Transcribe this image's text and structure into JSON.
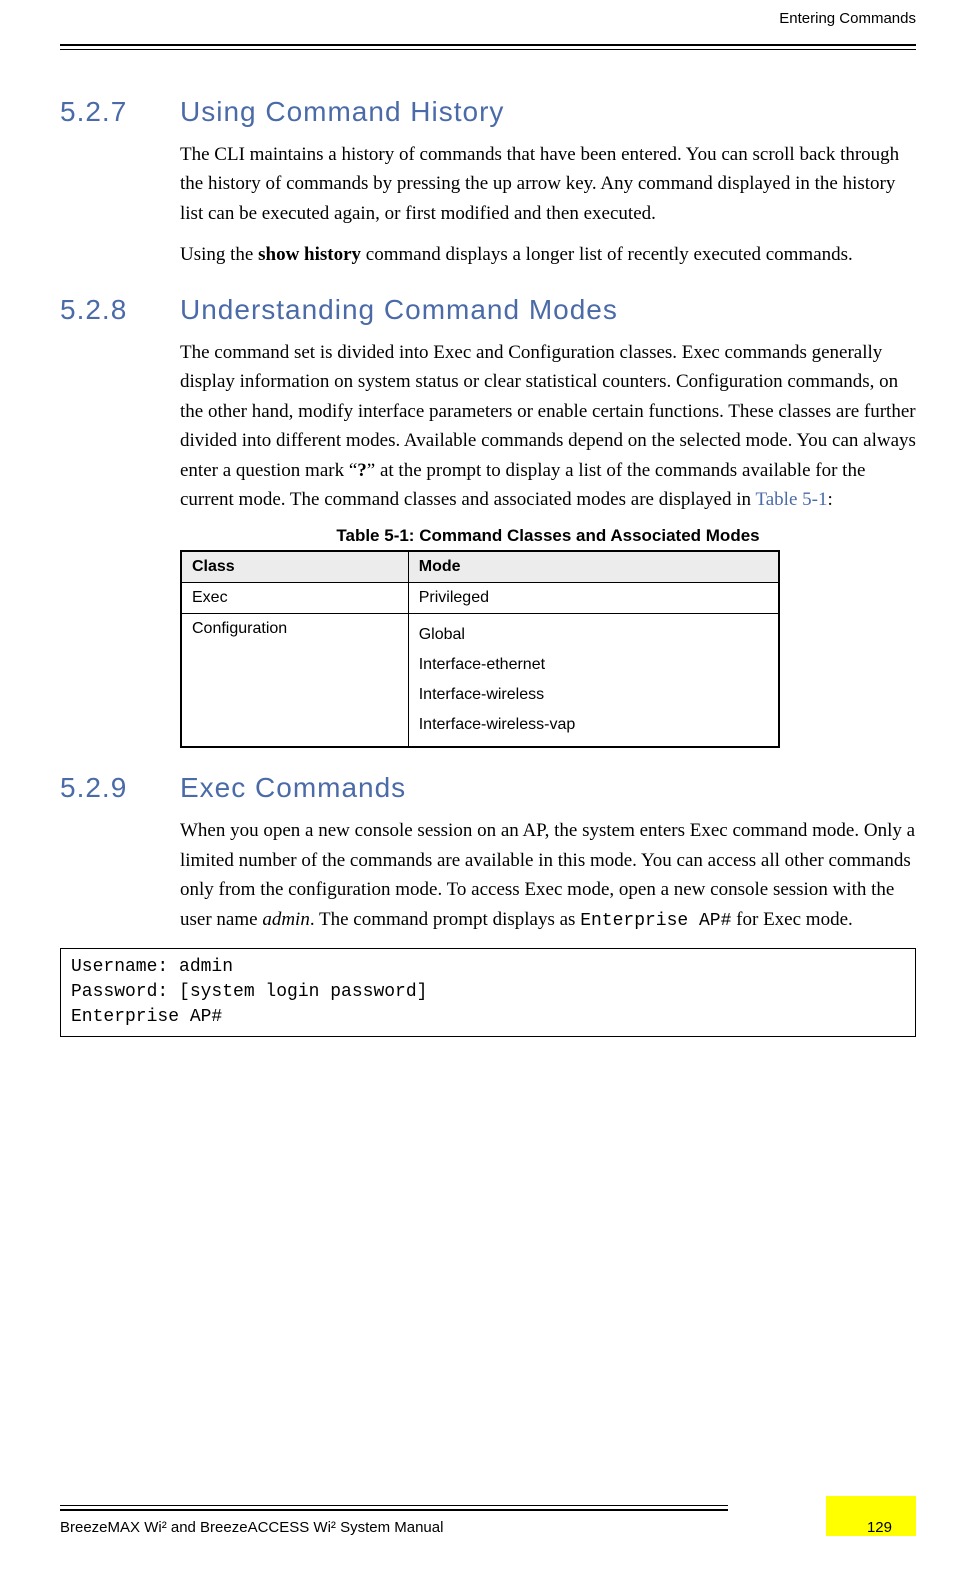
{
  "header": {
    "running_head": "Entering Commands"
  },
  "sections": {
    "s527": {
      "num": "5.2.7",
      "title": "Using Command History",
      "p1a": "The CLI maintains a history of commands that have been entered. You can scroll back through the history of commands by pressing the up arrow key. Any command displayed in the history list can be executed again, or first modified and then executed.",
      "p2_pre": "Using the ",
      "p2_bold": "show history",
      "p2_post": " command displays a longer list of recently executed commands."
    },
    "s528": {
      "num": "5.2.8",
      "title": "Understanding Command Modes",
      "p1_pre": "The command set is divided into Exec and Configuration classes. Exec commands generally display information on system status or clear statistical counters. Configuration commands, on the other hand, modify interface parameters or enable certain functions. These classes are further divided into different modes. Available commands depend on the selected mode. You can always enter a question mark “",
      "p1_q": "?",
      "p1_mid": "” at the prompt to display a list of the commands available for the current mode. The command classes and associated modes are displayed in ",
      "p1_link": "Table 5-1",
      "p1_post": ":",
      "table": {
        "caption": "Table 5-1: Command Classes and Associated Modes",
        "headers": {
          "col1": "Class",
          "col2": "Mode"
        },
        "rows": {
          "r1": {
            "class": "Exec",
            "mode": "Privileged"
          },
          "r2": {
            "class": "Configuration",
            "mode1": "Global",
            "mode2": "Interface-ethernet",
            "mode3": "Interface-wireless",
            "mode4": "Interface-wireless-vap"
          }
        }
      }
    },
    "s529": {
      "num": "5.2.9",
      "title": "Exec Commands",
      "p1_pre": "When you open a new console session on an AP, the system enters Exec command mode. Only a limited number of the commands are available in this mode. You can access all other commands only from the configuration mode. To access Exec mode, open a new console session with the user name ",
      "p1_italic": "admin",
      "p1_mid": ". The command prompt displays as ",
      "p1_mono": "Enterprise AP#",
      "p1_post": " for Exec mode.",
      "code": "Username: admin\nPassword: [system login password]\nEnterprise AP#"
    }
  },
  "footer": {
    "manual_title": "BreezeMAX Wi² and BreezeACCESS Wi² System Manual",
    "page_number": "129"
  }
}
